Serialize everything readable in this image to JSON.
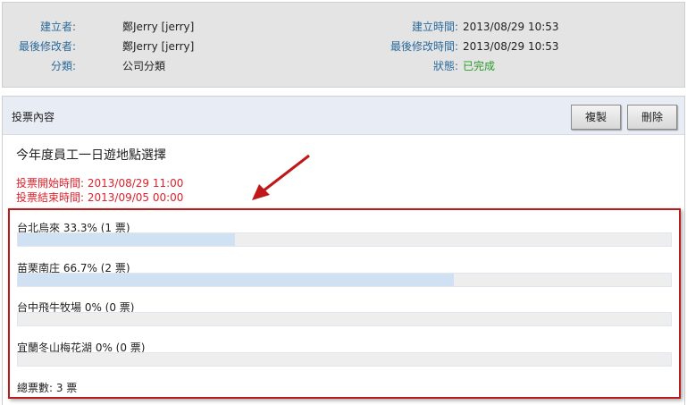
{
  "info": {
    "creator_label": "建立者:",
    "creator": "鄭Jerry [jerry]",
    "modifier_label": "最後修改者:",
    "modifier": "鄭Jerry [jerry]",
    "category_label": "分類:",
    "category": "公司分類",
    "created_label": "建立時間:",
    "created": "2013/08/29 10:53",
    "modified_label": "最後修改時間:",
    "modified": "2013/08/29 10:53",
    "status_label": "狀態:",
    "status": "已完成"
  },
  "panel": {
    "title": "投票內容",
    "copy_label": "複製",
    "delete_label": "刪除"
  },
  "vote": {
    "title": "今年度員工一日遊地點選擇",
    "start": "投票開始時間: 2013/08/29 11:00",
    "end": "投票結束時間: 2013/09/05 00:00",
    "options": [
      {
        "text": "台北烏來  33.3%  (1 票)",
        "percent": 33.3
      },
      {
        "text": "苗栗南庄  66.7%  (2 票)",
        "percent": 66.7
      },
      {
        "text": "台中飛牛牧場  0%  (0 票)",
        "percent": 0
      },
      {
        "text": "宜蘭冬山梅花湖  0%  (0 票)",
        "percent": 0
      }
    ],
    "total": "總票數: 3 票"
  }
}
